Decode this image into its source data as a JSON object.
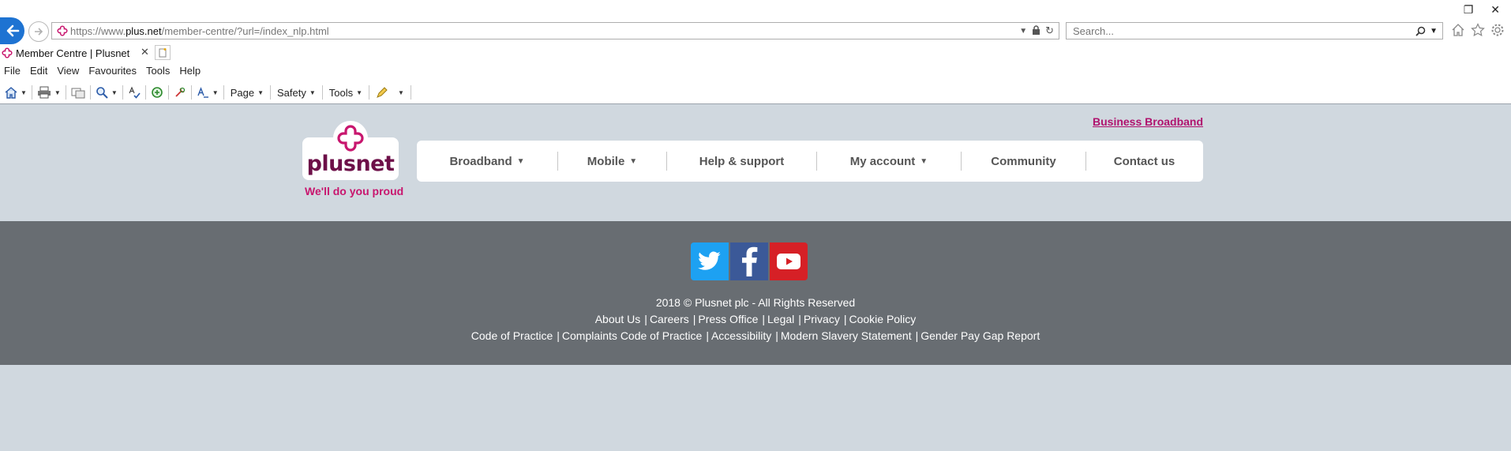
{
  "browser": {
    "url_scheme": "https://www.",
    "url_domain": "plus.net",
    "url_path": "/member-centre/?url=/index_nlp.html",
    "search_placeholder": "Search...",
    "tab_title": "Member Centre | Plusnet",
    "tab_close": "✕",
    "menu": [
      "File",
      "Edit",
      "View",
      "Favourites",
      "Tools",
      "Help"
    ],
    "commands": [
      "Page",
      "Safety",
      "Tools"
    ]
  },
  "header": {
    "business_link": "Business Broadband",
    "logo_word": "plusnet",
    "tagline": "We'll do you proud",
    "nav": [
      {
        "label": "Broadband",
        "has_dropdown": true
      },
      {
        "label": "Mobile",
        "has_dropdown": true
      },
      {
        "label": "Help & support",
        "has_dropdown": false
      },
      {
        "label": "My account",
        "has_dropdown": true
      },
      {
        "label": "Community",
        "has_dropdown": false
      },
      {
        "label": "Contact us",
        "has_dropdown": false
      }
    ]
  },
  "footer": {
    "social": [
      "twitter-icon",
      "facebook-icon",
      "youtube-icon"
    ],
    "copyright": "2018 © Plusnet plc - All Rights Reserved",
    "links_row1": [
      "About Us",
      "Careers",
      "Press Office",
      "Legal",
      "Privacy",
      "Cookie Policy"
    ],
    "links_row2": [
      "Code of Practice",
      "Complaints Code of Practice",
      "Accessibility",
      "Modern Slavery Statement",
      "Gender Pay Gap Report"
    ]
  },
  "colors": {
    "brand_pink": "#c8166e",
    "brand_plum": "#6d0f48",
    "page_bg": "#d0d8df",
    "footer_bg": "#686d72"
  }
}
